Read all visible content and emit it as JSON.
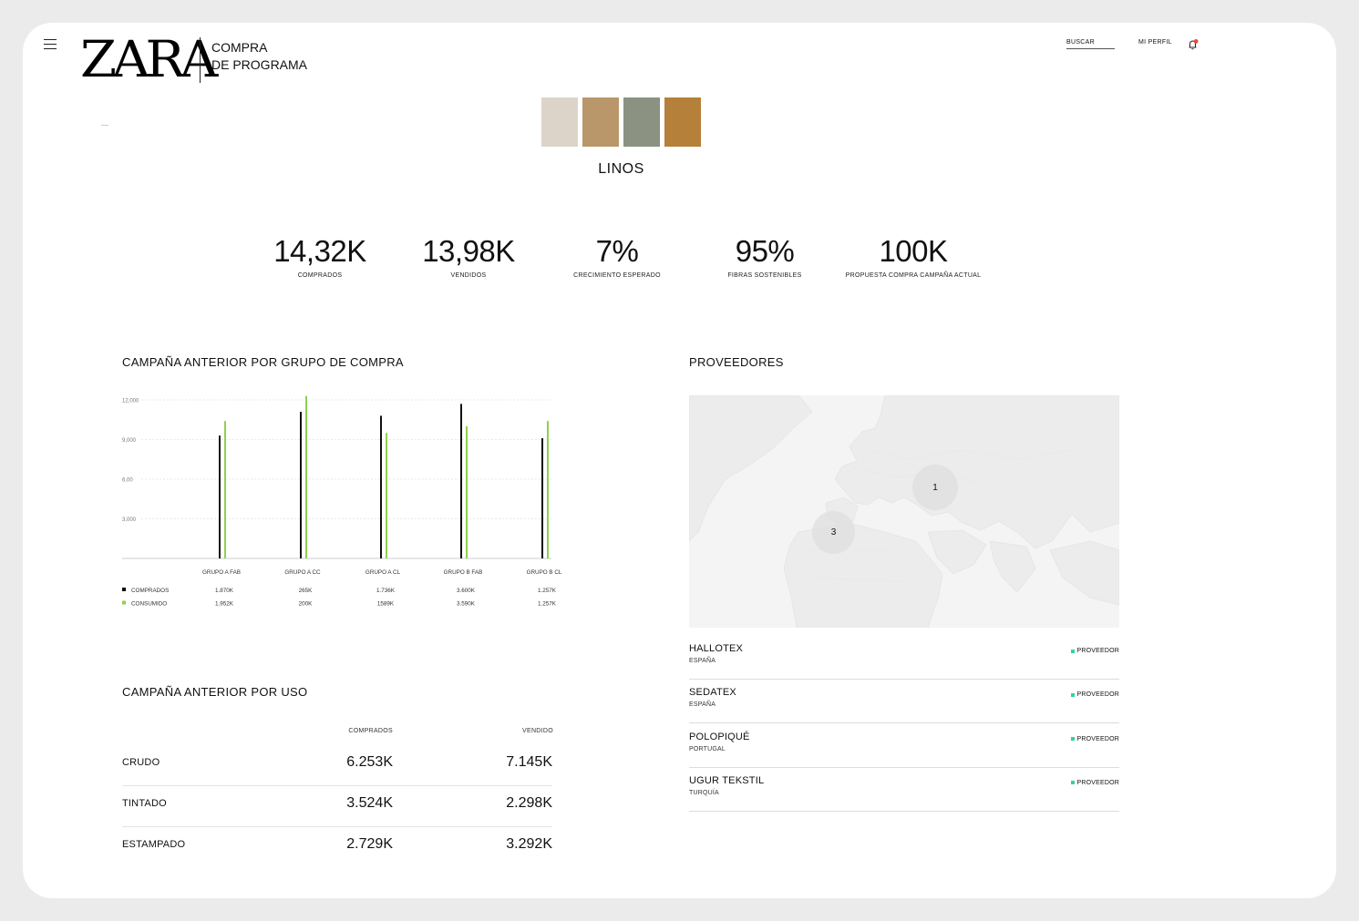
{
  "header": {
    "logo": "ZARA",
    "app_title_line1": "COMPRA",
    "app_title_line2": "DE PROGRAMA",
    "search_label": "BUSCAR",
    "profile_label": "MI PERFIL"
  },
  "colors": {
    "accent_green": "#8ed14f",
    "supplier_dot": "#2fd3a6",
    "notification": "#e84a3a"
  },
  "swatches": [
    "#dcd4c8",
    "#b9976b",
    "#8b9282",
    "#b4803a"
  ],
  "category": "LINOS",
  "kpis": [
    {
      "value": "14,32K",
      "label": "COMPRADOS"
    },
    {
      "value": "13,98K",
      "label": "VENDIDOS"
    },
    {
      "value": "7%",
      "label": "CRECIMIENTO ESPERADO"
    },
    {
      "value": "95%",
      "label": "FIBRAS SOSTENIBLES"
    },
    {
      "value": "100K",
      "label": "PROPUESTA COMPRA CAMPAÑA ACTUAL"
    }
  ],
  "chart_section_title": "CAMPAÑA ANTERIOR POR GRUPO DE COMPRA",
  "chart_data": {
    "type": "bar",
    "categories": [
      "GRUPO A FAB",
      "GRUPO A CC",
      "GRUPO A CL",
      "GRUPO B FAB",
      "GRUPO B CL"
    ],
    "series": [
      {
        "name": "COMPRADOS",
        "values": [
          9300,
          11100,
          10800,
          11700,
          9100
        ],
        "table": [
          "1.870K",
          "265K",
          "1.736K",
          "3.600K",
          "1.257K"
        ],
        "color": "#111111"
      },
      {
        "name": "CONSUMIDO",
        "values": [
          10400,
          12300,
          9500,
          10000,
          10400
        ],
        "table": [
          "1.952K",
          "200K",
          "1589K",
          "3.590K",
          "1.257K"
        ],
        "color": "#8ed14f"
      }
    ],
    "yticks": [
      "12,000",
      "9,000",
      "6,00",
      "3,000"
    ],
    "ytick_values": [
      12000,
      9000,
      6000,
      3000
    ],
    "ylim": [
      0,
      12000
    ],
    "grid": true,
    "legend": "bottom-left"
  },
  "uso": {
    "title": "CAMPAÑA ANTERIOR POR USO",
    "col1": "COMPRADOS",
    "col2": "VENDIDO",
    "rows": [
      {
        "label": "CRUDO",
        "comprados": "6.253K",
        "vendido": "7.145K"
      },
      {
        "label": "TINTADO",
        "comprados": "3.524K",
        "vendido": "2.298K"
      },
      {
        "label": "ESTAMPADO",
        "comprados": "2.729K",
        "vendido": "3.292K"
      }
    ]
  },
  "providers": {
    "title": "PROVEEDORES",
    "markers": [
      "1",
      "3"
    ],
    "list": [
      {
        "name": "HALLOTEX",
        "country": "ESPAÑA",
        "tag": "PROVEEDOR"
      },
      {
        "name": "SEDATEX",
        "country": "ESPAÑA",
        "tag": "PROVEEDOR"
      },
      {
        "name": "POLOPIQUÉ",
        "country": "PORTUGAL",
        "tag": "PROVEEDOR"
      },
      {
        "name": "UGUR TEKSTIL",
        "country": "TURQUÍA",
        "tag": "PROVEEDOR"
      }
    ]
  }
}
